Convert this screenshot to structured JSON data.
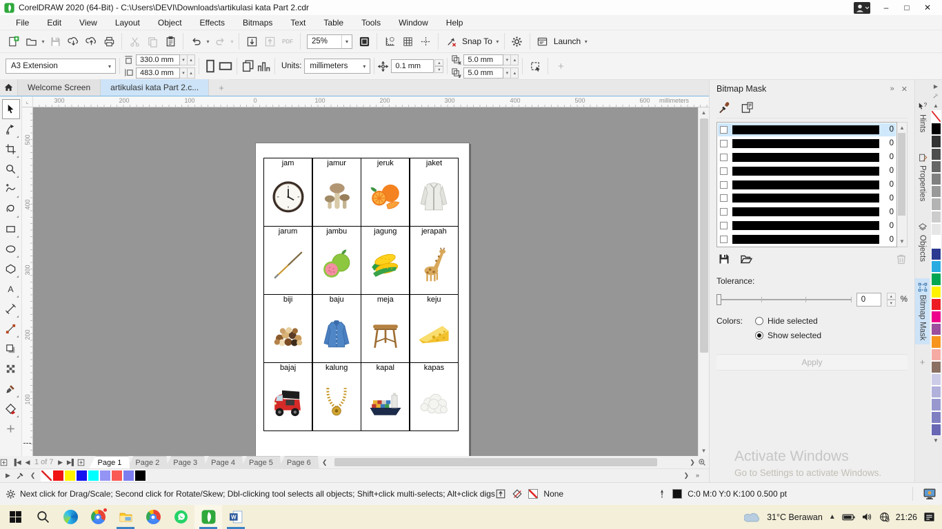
{
  "window": {
    "title": "CorelDRAW 2020 (64-Bit) - C:\\Users\\DEVI\\Downloads\\artikulasi kata Part 2.cdr"
  },
  "menu": {
    "items": [
      "File",
      "Edit",
      "View",
      "Layout",
      "Object",
      "Effects",
      "Bitmaps",
      "Text",
      "Table",
      "Tools",
      "Window",
      "Help"
    ]
  },
  "toolbar": {
    "zoom_level": "25%",
    "pdf_label": "PDF",
    "snap_to_label": "Snap To",
    "launch_label": "Launch"
  },
  "property_bar": {
    "page_size_preset": "A3 Extension",
    "page_width": "330.0 mm",
    "page_height": "483.0 mm",
    "units_label": "Units:",
    "units_value": "millimeters",
    "nudge_distance": "0.1 mm",
    "duplicate_x": "5.0 mm",
    "duplicate_y": "5.0 mm"
  },
  "document_tabs": {
    "welcome": "Welcome Screen",
    "document": "artikulasi kata Part 2.c..."
  },
  "rulers": {
    "horizontal_labels": [
      "300",
      "200",
      "100",
      "0",
      "100",
      "200",
      "300",
      "400",
      "500",
      "600"
    ],
    "units_label": "millimeters",
    "vertical_labels": [
      "500",
      "400",
      "300",
      "200",
      "100"
    ]
  },
  "page_grid": {
    "cells": [
      {
        "label": "jam",
        "icon": "clock"
      },
      {
        "label": "jamur",
        "icon": "mushroom"
      },
      {
        "label": "jeruk",
        "icon": "orange"
      },
      {
        "label": "jaket",
        "icon": "jacket"
      },
      {
        "label": "jarum",
        "icon": "needle"
      },
      {
        "label": "jambu",
        "icon": "guava"
      },
      {
        "label": "jagung",
        "icon": "corn"
      },
      {
        "label": "jerapah",
        "icon": "giraffe"
      },
      {
        "label": "biji",
        "icon": "seeds"
      },
      {
        "label": "baju",
        "icon": "shirt"
      },
      {
        "label": "meja",
        "icon": "table"
      },
      {
        "label": "keju",
        "icon": "cheese"
      },
      {
        "label": "bajaj",
        "icon": "rickshaw"
      },
      {
        "label": "kalung",
        "icon": "necklace"
      },
      {
        "label": "kapal",
        "icon": "ship"
      },
      {
        "label": "kapas",
        "icon": "cotton"
      }
    ]
  },
  "docker": {
    "title": "Bitmap Mask",
    "mask_rows": [
      {
        "value": "0"
      },
      {
        "value": "0"
      },
      {
        "value": "0"
      },
      {
        "value": "0"
      },
      {
        "value": "0"
      },
      {
        "value": "0"
      },
      {
        "value": "0"
      },
      {
        "value": "0"
      },
      {
        "value": "0"
      }
    ],
    "selected_row_index": 0,
    "tolerance_label": "Tolerance:",
    "tolerance_value": "0",
    "tolerance_unit": "%",
    "colors_label": "Colors:",
    "radio_hide_label": "Hide selected",
    "radio_show_label": "Show selected",
    "radio_selected": "show",
    "apply_label": "Apply",
    "tabs": [
      "Hints",
      "Properties",
      "Objects",
      "Bitmap Mask"
    ],
    "active_tab": "Bitmap Mask"
  },
  "page_nav": {
    "position": "1 of 7",
    "pages": [
      "Page 1",
      "Page 2",
      "Page 3",
      "Page 4",
      "Page 5",
      "Page 6"
    ],
    "active_page": "Page 1"
  },
  "status_bar": {
    "hint": "Next click for Drag/Scale; Second click for Rotate/Skew; Dbl-clicking tool selects all objects; Shift+click multi-selects; Alt+click digs",
    "fill_label": "None",
    "outline_value": "C:0 M:0 Y:0 K:100  0.500 pt"
  },
  "taskbar": {
    "weather": "31°C Berawan",
    "time": "21:26"
  },
  "watermark": {
    "line1": "Activate Windows",
    "line2": "Go to Settings to activate Windows."
  },
  "palettes": {
    "right": [
      "none",
      "#000000",
      "#333333",
      "#4d4d4d",
      "#666666",
      "#808080",
      "#999999",
      "#b3b3b3",
      "#cccccc",
      "#e6e6e6",
      "#ffffff",
      "#2b3990",
      "#29abe2",
      "#00a651",
      "#fff200",
      "#ed1c24",
      "#ec008c",
      "#9c4d9e",
      "#f7941d",
      "#f5aaa4",
      "#8a7164",
      "#ccccE8",
      "#b1b1dc",
      "#9898cf",
      "#7f7fc2",
      "#6868b5"
    ],
    "bottom": [
      "none",
      "#f01414",
      "#fff200",
      "#1414f0",
      "#00ffff",
      "#9494f5",
      "#fa5a55",
      "#7d7df0",
      "#000000"
    ]
  },
  "colors": {
    "accent_blue": "#3b82c4",
    "active_doc_tab_bg": "#cde3f7",
    "canvas_bg": "#969696",
    "taskbar_bg": "#f3efd9",
    "selected_mask_row_bg": "#cfe8fb"
  }
}
